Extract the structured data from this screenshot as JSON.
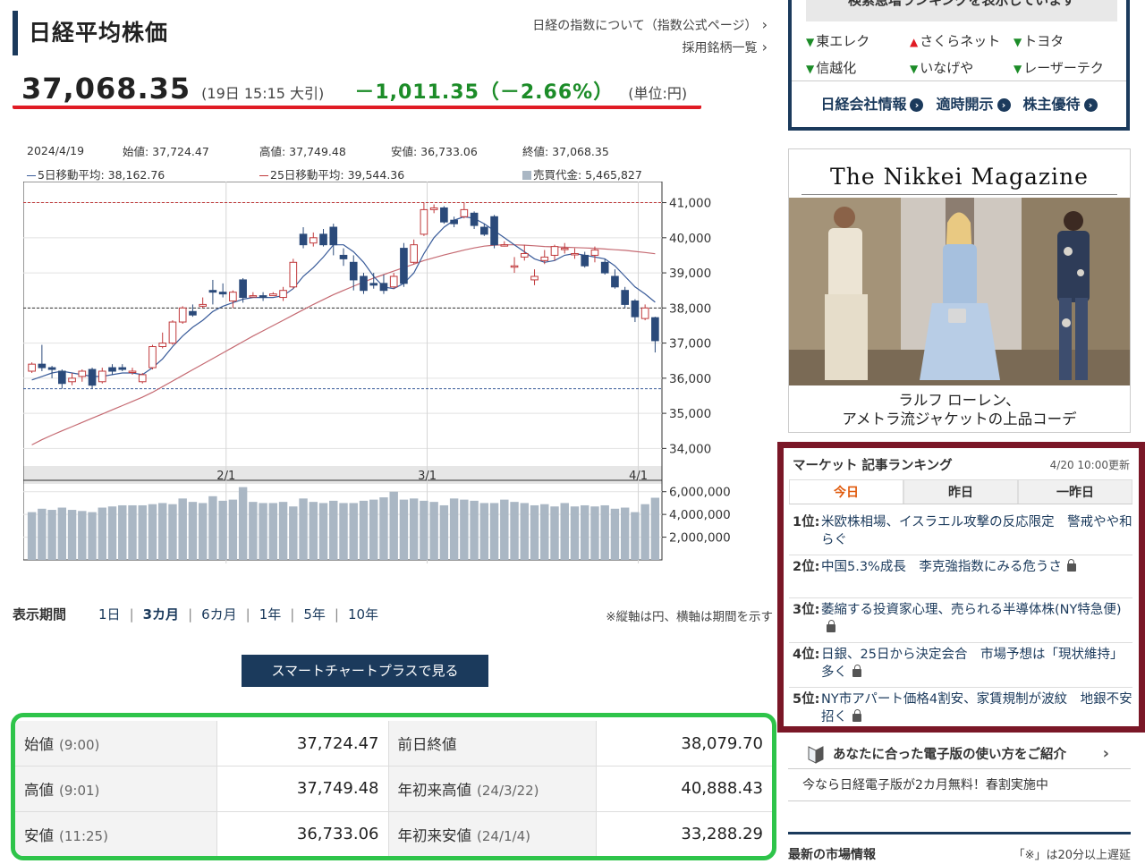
{
  "header": {
    "title": "日経平均株価",
    "link_index": "日経の指数について（指数公式ページ）",
    "link_components": "採用銘柄一覧"
  },
  "price": {
    "value": "37,068.35",
    "time": "(19日 15:15 大引)",
    "change": "－1,011.35（－2.66%）",
    "unit": "(単位:円)"
  },
  "legend": {
    "date": "2024/4/19",
    "open": "始値: 37,724.47",
    "high": "高値: 37,749.48",
    "low": "安値: 36,733.06",
    "close": "終値: 37,068.35",
    "ma5": "5日移動平均: 38,162.76",
    "ma25": "25日移動平均: 39,544.36",
    "volume": "売買代金: 5,465,827"
  },
  "chart_data": {
    "type": "candlestick",
    "y_ticks": [
      "41,000",
      "40,000",
      "39,000",
      "38,000",
      "37,000",
      "36,000",
      "35,000",
      "34,000"
    ],
    "ylim": [
      33500,
      41600
    ],
    "x_ticks": [
      "2/1",
      "3/1",
      "4/1"
    ],
    "volume_ticks": [
      "6,000,000",
      "4,000,000",
      "2,000,000"
    ],
    "volume_ylim": [
      0,
      7000000
    ],
    "ref_lines": [
      41000,
      38000,
      35700
    ],
    "candles": [
      [
        36200,
        36400,
        36150,
        36450
      ],
      [
        36400,
        36300,
        36200,
        36950
      ],
      [
        36300,
        36250,
        36000,
        36350
      ],
      [
        36200,
        35850,
        35700,
        36250
      ],
      [
        35900,
        36000,
        35800,
        36150
      ],
      [
        36050,
        36200,
        35900,
        36250
      ],
      [
        36250,
        35800,
        35700,
        36300
      ],
      [
        35900,
        36200,
        35850,
        36300
      ],
      [
        36300,
        36200,
        36100,
        36400
      ],
      [
        36300,
        36250,
        36200,
        36400
      ],
      [
        36200,
        36200,
        36100,
        36300
      ],
      [
        35900,
        36100,
        35850,
        36150
      ],
      [
        36300,
        36900,
        36250,
        36950
      ],
      [
        36900,
        37000,
        36850,
        37300
      ],
      [
        37000,
        37600,
        36950,
        37650
      ],
      [
        37600,
        38000,
        37550,
        38050
      ],
      [
        37900,
        37800,
        37750,
        38100
      ],
      [
        38050,
        38100,
        38000,
        38300
      ],
      [
        38500,
        38450,
        38100,
        38800
      ],
      [
        38450,
        38400,
        38300,
        38700
      ],
      [
        38200,
        38450,
        38000,
        38500
      ],
      [
        38800,
        38300,
        38150,
        38850
      ],
      [
        38350,
        38350,
        38300,
        38450
      ],
      [
        38350,
        38300,
        38200,
        38450
      ],
      [
        38350,
        38400,
        38350,
        38450
      ],
      [
        38300,
        38500,
        38200,
        38600
      ],
      [
        38600,
        39300,
        38550,
        39400
      ],
      [
        40100,
        39800,
        39700,
        40300
      ],
      [
        39850,
        40000,
        39750,
        40150
      ],
      [
        40100,
        39800,
        39750,
        40250
      ],
      [
        40300,
        39800,
        39500,
        40400
      ],
      [
        39500,
        39400,
        39200,
        39700
      ],
      [
        39300,
        38800,
        38500,
        39500
      ],
      [
        38900,
        38500,
        38400,
        39000
      ],
      [
        38700,
        38650,
        38550,
        39000
      ],
      [
        38700,
        38500,
        38400,
        38950
      ],
      [
        38600,
        38900,
        38550,
        39000
      ],
      [
        39700,
        38700,
        38600,
        39850
      ],
      [
        39300,
        39800,
        39250,
        39950
      ],
      [
        40100,
        40800,
        40050,
        41000
      ],
      [
        40800,
        40850,
        40700,
        40950
      ],
      [
        40850,
        40450,
        40400,
        40900
      ],
      [
        40500,
        40400,
        40300,
        40600
      ],
      [
        40600,
        40800,
        40550,
        41000
      ],
      [
        40700,
        40350,
        40250,
        40750
      ],
      [
        40300,
        40100,
        40050,
        40400
      ],
      [
        40600,
        39800,
        39700,
        40650
      ],
      [
        39800,
        39800,
        39750,
        39900
      ],
      [
        39200,
        39200,
        39000,
        39450
      ],
      [
        39450,
        39550,
        39350,
        39800
      ],
      [
        38800,
        38900,
        38650,
        39100
      ],
      [
        39350,
        39450,
        39250,
        39650
      ],
      [
        39500,
        39750,
        39350,
        39800
      ],
      [
        39700,
        39700,
        39550,
        39850
      ],
      [
        39550,
        39550,
        39400,
        39700
      ],
      [
        39500,
        39200,
        39150,
        39600
      ],
      [
        39500,
        39650,
        39300,
        39750
      ],
      [
        39300,
        39000,
        38950,
        39400
      ],
      [
        38900,
        38600,
        38550,
        39100
      ],
      [
        38500,
        38100,
        38000,
        38600
      ],
      [
        38200,
        37750,
        37600,
        38250
      ],
      [
        37700,
        38000,
        37650,
        38100
      ],
      [
        37724.47,
        37068.35,
        36733.06,
        37749.48
      ]
    ],
    "ma5": [
      35950,
      36050,
      36150,
      36200,
      36150,
      36100,
      36050,
      36050,
      36100,
      36150,
      36150,
      36100,
      36300,
      36550,
      36900,
      37200,
      37450,
      37650,
      37900,
      38050,
      38150,
      38250,
      38300,
      38300,
      38300,
      38350,
      38550,
      38900,
      39150,
      39450,
      39800,
      39800,
      39600,
      39300,
      38900,
      38600,
      38550,
      38700,
      39000,
      39550,
      40000,
      40300,
      40500,
      40600,
      40550,
      40400,
      40200,
      40000,
      39800,
      39600,
      39400,
      39300,
      39350,
      39500,
      39550,
      39500,
      39450,
      39400,
      39200,
      38900,
      38600,
      38400,
      38162.76
    ],
    "ma25": [
      34100,
      34250,
      34380,
      34500,
      34620,
      34740,
      34860,
      34980,
      35100,
      35220,
      35340,
      35460,
      35600,
      35760,
      35920,
      36080,
      36240,
      36400,
      36560,
      36720,
      36880,
      37040,
      37200,
      37350,
      37500,
      37650,
      37800,
      37950,
      38100,
      38240,
      38380,
      38500,
      38620,
      38740,
      38850,
      38950,
      39050,
      39150,
      39250,
      39350,
      39430,
      39510,
      39580,
      39650,
      39710,
      39760,
      39790,
      39800,
      39800,
      39790,
      39770,
      39750,
      39740,
      39730,
      39720,
      39710,
      39700,
      39680,
      39660,
      39640,
      39610,
      39580,
      39544.36
    ],
    "volume": [
      4200000,
      4500000,
      4400000,
      4600000,
      4400000,
      4300000,
      4200000,
      4600000,
      4700000,
      4800000,
      4800000,
      4800000,
      4900000,
      5000000,
      4900000,
      5400000,
      5100000,
      5000000,
      5600000,
      5200000,
      5300000,
      6400000,
      5100000,
      5000000,
      5000000,
      5100000,
      4700000,
      5400000,
      5100000,
      5000000,
      5200000,
      5000000,
      5000000,
      5200000,
      5300000,
      5500000,
      6000000,
      5300000,
      5400000,
      5200000,
      5100000,
      4800000,
      5400000,
      5300000,
      5200000,
      5000000,
      5000000,
      5300000,
      5100000,
      5000000,
      4800000,
      4900000,
      4700000,
      5000000,
      4700000,
      4800000,
      4700000,
      4800000,
      4500000,
      4600000,
      4200000,
      4900000,
      5465827
    ]
  },
  "period": {
    "label": "表示期間",
    "options": [
      "1日",
      "3カ月",
      "6カ月",
      "1年",
      "5年",
      "10年"
    ],
    "active": "3カ月",
    "note": "※縦軸は円、横軸は期間を示す"
  },
  "smart_chart_button": "スマートチャートプラスで見る",
  "stats": {
    "rows": [
      {
        "k": "始値",
        "ks": "(9:00)",
        "v": "37,724.47",
        "k2": "前日終値",
        "k2s": "",
        "v2": "38,079.70"
      },
      {
        "k": "高値",
        "ks": "(9:01)",
        "v": "37,749.48",
        "k2": "年初来高値",
        "k2s": "(24/3/22)",
        "v2": "40,888.43"
      },
      {
        "k": "安値",
        "ks": "(11:25)",
        "v": "36,733.06",
        "k2": "年初来安値",
        "k2s": "(24/1/4)",
        "v2": "33,288.29"
      }
    ]
  },
  "search_ranking": {
    "banner": "検索急増ランキングを表示しています",
    "items": [
      {
        "label": "東エレク",
        "dir": "down"
      },
      {
        "label": "さくらネット",
        "dir": "up"
      },
      {
        "label": "トヨタ",
        "dir": "down"
      },
      {
        "label": "信越化",
        "dir": "down"
      },
      {
        "label": "いなげや",
        "dir": "down"
      },
      {
        "label": "レーザーテク",
        "dir": "down"
      }
    ],
    "links": [
      "日経会社情報",
      "適時開示",
      "株主優待"
    ]
  },
  "magazine": {
    "title": "The Nikkei Magazine",
    "caption_line1": "ラルフ ローレン、",
    "caption_line2": "アメトラ流ジャケットの上品コーデ"
  },
  "market_ranking": {
    "heading": "マーケット 記事ランキング",
    "updated": "4/20 10:00更新",
    "tabs": [
      "今日",
      "昨日",
      "一昨日"
    ],
    "items": [
      {
        "rank": "1位:",
        "title": "米欧株相場、イスラエル攻撃の反応限定　警戒やや和らぐ",
        "locked": false
      },
      {
        "rank": "2位:",
        "title": "中国5.3%成長　李克強指数にみる危うさ",
        "locked": true
      },
      {
        "rank": "3位:",
        "title": "萎縮する投資家心理、売られる半導体株(NY特急便)",
        "locked": true
      },
      {
        "rank": "4位:",
        "title": "日銀、25日から決定会合　市場予想は「現状維持」多く",
        "locked": true
      },
      {
        "rank": "5位:",
        "title": "NY市アパート価格4割安、家賃規制が波紋　地銀不安招く",
        "locked": true
      }
    ]
  },
  "guide": {
    "title": "あなたに合った電子版の使い方をご紹介",
    "sub": "今なら日経電子版が2カ月無料！春割実施中"
  },
  "latest": {
    "heading": "最新の市場情報",
    "note": "「※」は20分以上遅延"
  },
  "colors": {
    "navy": "#1b3a5c",
    "up": "#c0393b",
    "down": "#2b4a7a",
    "change_down": "#1c8c28",
    "price_underline": "#e01b24",
    "stats_border": "#2ec44a",
    "ranking_border": "#7a1727"
  }
}
